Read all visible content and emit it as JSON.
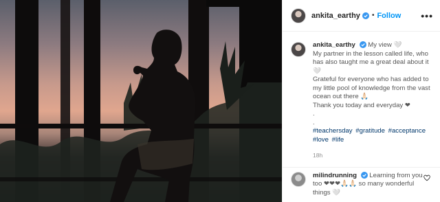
{
  "post": {
    "username": "ankita_earthy",
    "follow_label": "Follow",
    "separator": "•",
    "more_label": "•••"
  },
  "caption": {
    "username": "ankita_earthy",
    "lines": [
      "My view 🤍",
      "My partner in the lesson called life, who has also taught me a great deal about it🤍",
      "Grateful for everyone who has added to my little pool of knowledge from the vast ocean out there 🙏🏻",
      "Thank you today and everyday ❤",
      ".",
      "."
    ],
    "hashtags": [
      "#teachersday",
      "#gratitude",
      "#acceptance",
      "#love",
      "#life"
    ],
    "timestamp": "18h"
  },
  "comment": {
    "username": "milindrunning",
    "text": "Learning from you too ❤❤❤🙏🏻🙏🏻 so many wonderful things 🤍"
  },
  "colors": {
    "accent": "#0095f6",
    "verified": "#3897f0",
    "hashtag": "#00376b"
  },
  "icons": [
    "verified-badge-icon",
    "more-options-icon",
    "heart-icon"
  ]
}
